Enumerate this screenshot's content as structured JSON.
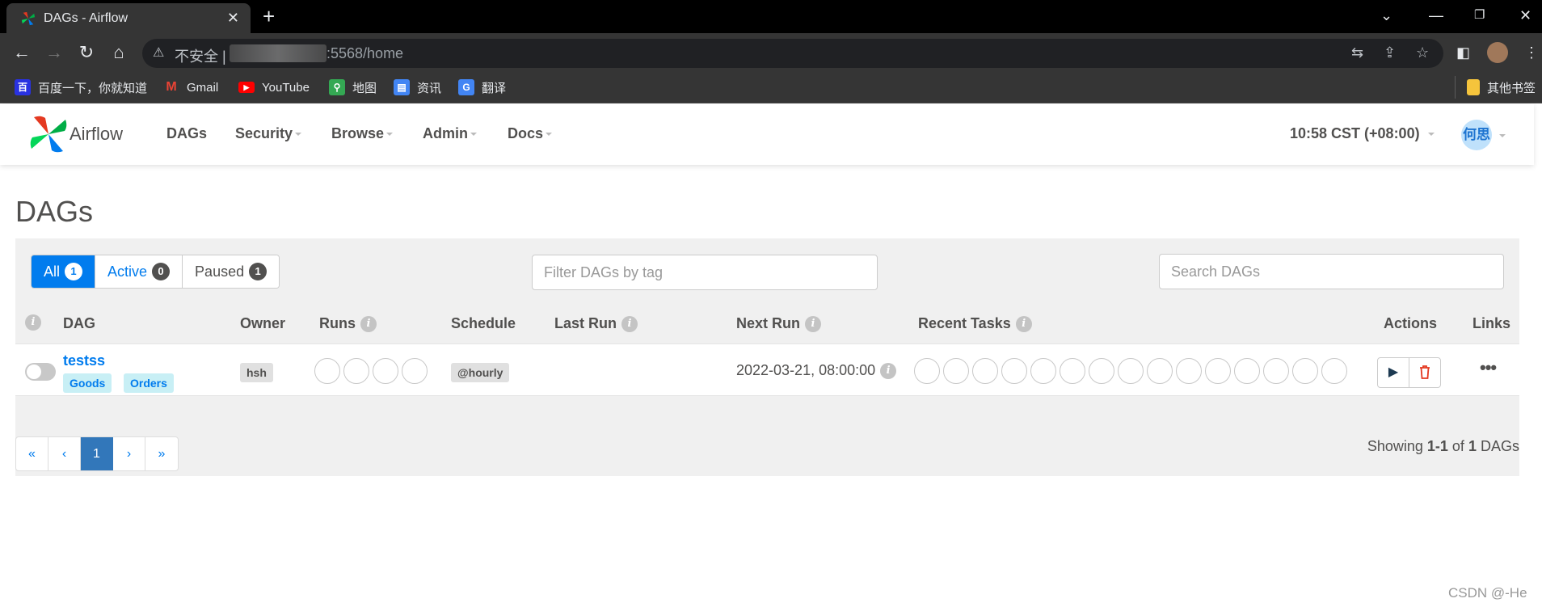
{
  "browser": {
    "tab_title": "DAGs - Airflow",
    "new_tab": "+",
    "address": {
      "warning": "不安全",
      "separator": "|",
      "url_visible": ":5568/home"
    },
    "bookmarks": [
      {
        "label": "百度一下，你就知道",
        "icon": "baidu-icon",
        "color": "#2932e1"
      },
      {
        "label": "Gmail",
        "icon": "gmail-icon",
        "color": "#ea4335"
      },
      {
        "label": "YouTube",
        "icon": "youtube-icon",
        "color": "#ff0000"
      },
      {
        "label": "地图",
        "icon": "maps-icon",
        "color": "#34a853"
      },
      {
        "label": "资讯",
        "icon": "news-icon",
        "color": "#4285f4"
      },
      {
        "label": "翻译",
        "icon": "translate-icon",
        "color": "#4285f4"
      }
    ],
    "other_bookmarks": "其他书签"
  },
  "nav": {
    "brand": "Airflow",
    "items": [
      "DAGs",
      "Security",
      "Browse",
      "Admin",
      "Docs"
    ],
    "clock": "10:58 CST (+08:00)",
    "user_avatar": "何思"
  },
  "page": {
    "title": "DAGs",
    "filters": [
      {
        "label": "All",
        "count": "1"
      },
      {
        "label": "Active",
        "count": "0"
      },
      {
        "label": "Paused",
        "count": "1"
      }
    ],
    "tag_filter_placeholder": "Filter DAGs by tag",
    "search_placeholder": "Search DAGs",
    "columns": [
      "DAG",
      "Owner",
      "Runs",
      "Schedule",
      "Last Run",
      "Next Run",
      "Recent Tasks",
      "Actions",
      "Links"
    ],
    "row": {
      "dag_id": "testss",
      "tags": [
        "Goods",
        "Orders"
      ],
      "owner": "hsh",
      "schedule": "@hourly",
      "last_run": "",
      "next_run": "2022-03-21, 08:00:00"
    },
    "pagination": [
      "«",
      "‹",
      "1",
      "›",
      "»"
    ],
    "showing": {
      "prefix": "Showing",
      "range": "1-1",
      "mid": "of",
      "total": "1",
      "suffix": "DAGs"
    }
  },
  "watermark": "CSDN @-He",
  "colors": {
    "accent": "#017cee",
    "tag_bg": "#c8eff5",
    "delete": "#e43921"
  }
}
